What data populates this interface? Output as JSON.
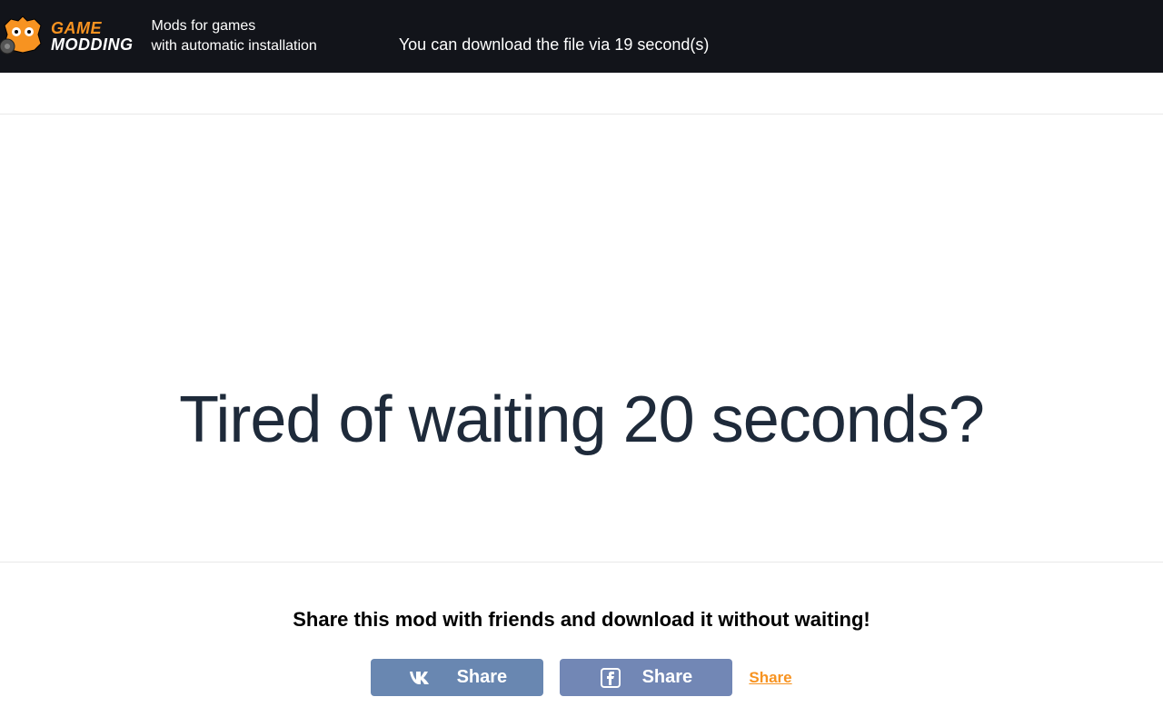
{
  "header": {
    "logo": {
      "text_top": "GAME",
      "text_bottom": "MODDING"
    },
    "tagline_line1": "Mods for games",
    "tagline_line2": "with automatic installation",
    "countdown_message": "You can download the file via 19 second(s)"
  },
  "main": {
    "headline": "Tired of waiting 20 seconds?"
  },
  "share": {
    "heading": "Share this mod with friends and download it without waiting!",
    "vk_label": "Share",
    "fb_label": "Share",
    "share_link_label": "Share"
  }
}
